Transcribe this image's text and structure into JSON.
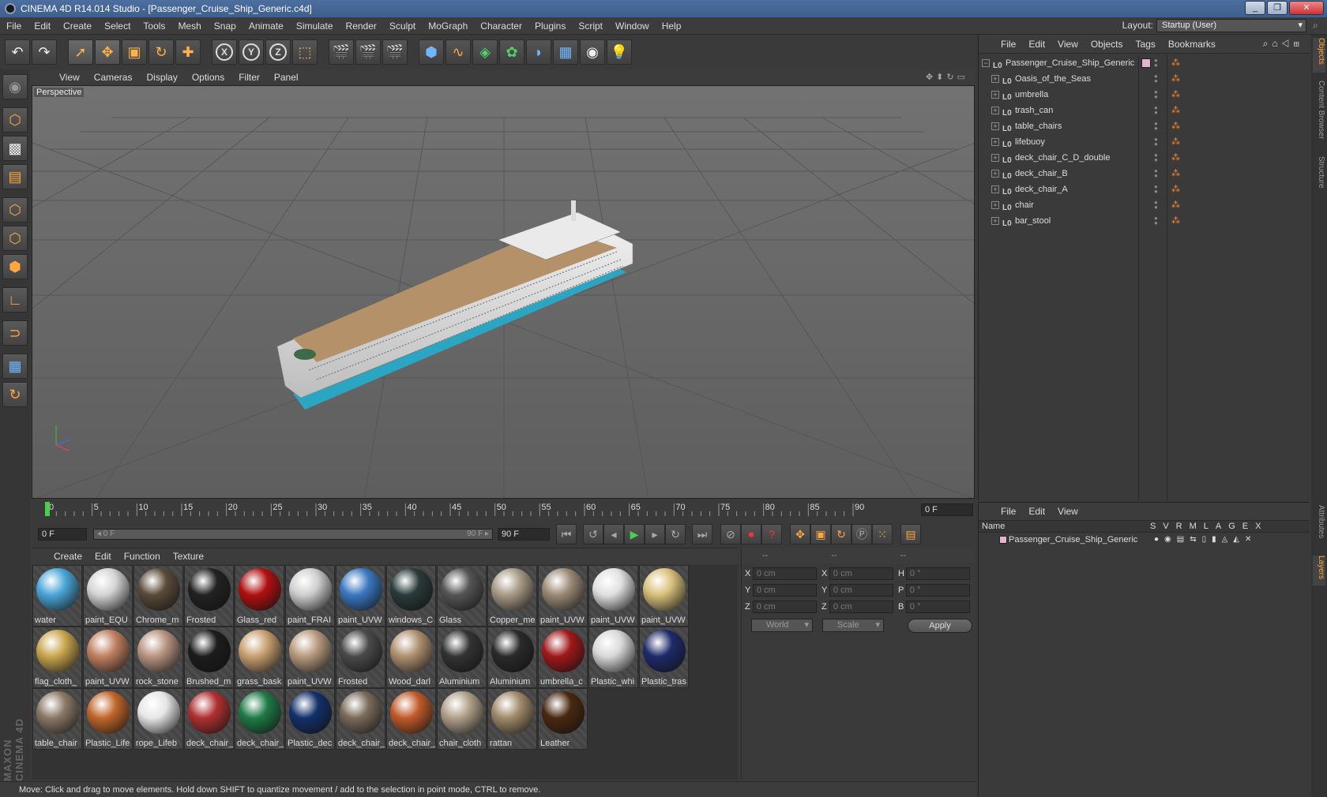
{
  "window": {
    "title": "CINEMA 4D R14.014 Studio - [Passenger_Cruise_Ship_Generic.c4d]",
    "buttons": [
      "_",
      "❐",
      "✕"
    ]
  },
  "menubar": {
    "items": [
      "File",
      "Edit",
      "Create",
      "Select",
      "Tools",
      "Mesh",
      "Snap",
      "Animate",
      "Simulate",
      "Render",
      "Sculpt",
      "MoGraph",
      "Character",
      "Plugins",
      "Script",
      "Window",
      "Help"
    ],
    "layout_label": "Layout:",
    "layout_value": "Startup (User)"
  },
  "viewport": {
    "menu": [
      "View",
      "Cameras",
      "Display",
      "Options",
      "Filter",
      "Panel"
    ],
    "label": "Perspective"
  },
  "timeline": {
    "ticks": [
      "0",
      "5",
      "10",
      "15",
      "20",
      "25",
      "30",
      "35",
      "40",
      "45",
      "50",
      "55",
      "60",
      "65",
      "70",
      "75",
      "80",
      "85",
      "90"
    ],
    "current_frame": "0 F"
  },
  "transport": {
    "start": "0 F",
    "slider_left": "◂ 0 F",
    "slider_right": "90 F ▸",
    "end": "90 F"
  },
  "materials": {
    "menu": [
      "Create",
      "Edit",
      "Function",
      "Texture"
    ],
    "items": [
      {
        "label": "water",
        "color": "#4aa6d8"
      },
      {
        "label": "paint_EQU",
        "color": "#d4d4d4"
      },
      {
        "label": "Chrome_m",
        "color": "#5a4a3a"
      },
      {
        "label": "Frosted",
        "color": "#222222"
      },
      {
        "label": "Glass_red",
        "color": "#b01010"
      },
      {
        "label": "paint_FRAI",
        "color": "#cfcfcf"
      },
      {
        "label": "paint_UVW",
        "color": "#3a78c0"
      },
      {
        "label": "windows_C",
        "color": "#2a3a3a"
      },
      {
        "label": "Glass",
        "color": "#555555"
      },
      {
        "label": "Copper_me",
        "color": "#a89a86"
      },
      {
        "label": "paint_UVW",
        "color": "#9a8a76"
      },
      {
        "label": "paint_UVW",
        "color": "#e0e0e0"
      },
      {
        "label": "paint_UVW",
        "color": "#d8c07a"
      },
      {
        "label": "flag_cloth_",
        "color": "#c9a64e"
      },
      {
        "label": "paint_UVW",
        "color": "#c08060"
      },
      {
        "label": "rock_stone",
        "color": "#b89480"
      },
      {
        "label": "Brushed_m",
        "color": "#1c1c1c"
      },
      {
        "label": "grass_bask",
        "color": "#c8a070"
      },
      {
        "label": "paint_UVW",
        "color": "#b89a7e"
      },
      {
        "label": "Frosted",
        "color": "#4a4a4a"
      },
      {
        "label": "Wood_darl",
        "color": "#b09070"
      },
      {
        "label": "Aluminium",
        "color": "#333333"
      },
      {
        "label": "Aluminium",
        "color": "#2a2a2a"
      },
      {
        "label": "umbrella_c",
        "color": "#a01818"
      },
      {
        "label": "Plastic_whi",
        "color": "#d8d8d8"
      },
      {
        "label": "Plastic_tras",
        "color": "#1e2a6a"
      },
      {
        "label": "table_chair",
        "color": "#8a7866"
      },
      {
        "label": "Plastic_Life",
        "color": "#c0662a"
      },
      {
        "label": "rope_Lifeb",
        "color": "#e6e6e6"
      },
      {
        "label": "deck_chair_",
        "color": "#b03030"
      },
      {
        "label": "deck_chair_",
        "color": "#1e7a46"
      },
      {
        "label": "Plastic_dec",
        "color": "#13306a"
      },
      {
        "label": "deck_chair_",
        "color": "#7a6a5a"
      },
      {
        "label": "deck_chair_",
        "color": "#c05a2a"
      },
      {
        "label": "chair_cloth",
        "color": "#b0a08a"
      },
      {
        "label": "rattan",
        "color": "#a08a6a"
      },
      {
        "label": "Leather",
        "color": "#4a2810"
      }
    ]
  },
  "coords": {
    "headers": [
      "--",
      "--",
      "--"
    ],
    "rows": [
      {
        "a1": "X",
        "v1": "0 cm",
        "a2": "X",
        "v2": "0 cm",
        "a3": "H",
        "v3": "0 °"
      },
      {
        "a1": "Y",
        "v1": "0 cm",
        "a2": "Y",
        "v2": "0 cm",
        "a3": "P",
        "v3": "0 °"
      },
      {
        "a1": "Z",
        "v1": "0 cm",
        "a2": "Z",
        "v2": "0 cm",
        "a3": "B",
        "v3": "0 °"
      }
    ],
    "space": "World",
    "mode": "Scale",
    "apply": "Apply"
  },
  "statusbar": "Move: Click and drag to move elements. Hold down SHIFT to quantize movement / add to the selection in point mode, CTRL to remove.",
  "objects": {
    "menu": [
      "File",
      "Edit",
      "View",
      "Objects",
      "Tags",
      "Bookmarks"
    ],
    "root": "Passenger_Cruise_Ship_Generic",
    "children": [
      "Oasis_of_the_Seas",
      "umbrella",
      "trash_can",
      "table_chairs",
      "lifebuoy",
      "deck_chair_C_D_double",
      "deck_chair_B",
      "deck_chair_A",
      "chair",
      "bar_stool"
    ],
    "null_icon": "L0"
  },
  "layers": {
    "menu": [
      "File",
      "Edit",
      "View"
    ],
    "name_header": "Name",
    "cols": "SVRMLAGEX",
    "rows": [
      "Passenger_Cruise_Ship_Generic"
    ]
  },
  "vtabs": [
    "Objects",
    "Content Browser",
    "Structure",
    "Attributes",
    "Layers"
  ],
  "brand": "MAXON CINEMA 4D",
  "colors": {
    "accent": "#ffa640",
    "play": "#49d04b",
    "layer_swatch": "#e7b4c8"
  }
}
